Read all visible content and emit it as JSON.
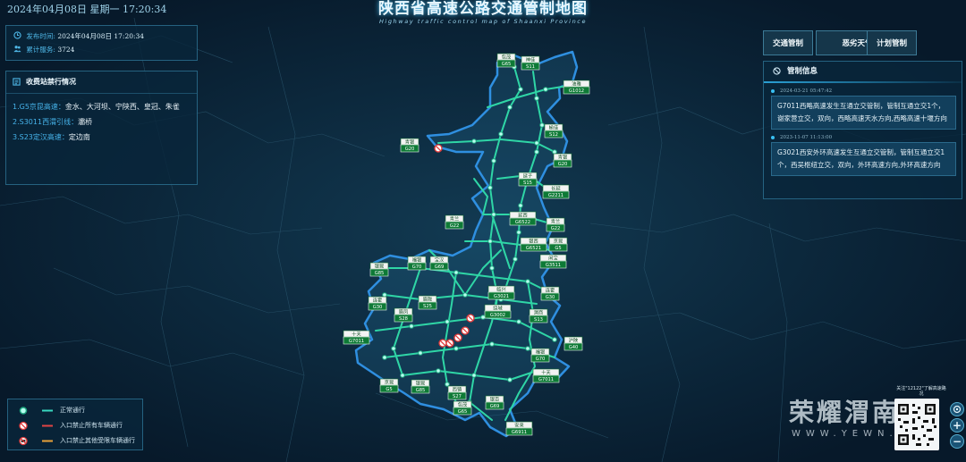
{
  "header": {
    "datetime": "2024年04月08日 星期一 17:20:34",
    "title": "陕西省高速公路交通管制地图",
    "title_en": "Highway traffic control map of Shaanxi Province"
  },
  "info_panel": {
    "publish_label": "发布时间:",
    "publish_value": "2024年04月08日 17:20:34",
    "service_label": "累计服务:",
    "service_value": "3724"
  },
  "toll_panel": {
    "title": "收费站禁行情况",
    "items": [
      {
        "road": "1.G5京昆高速：",
        "stations": "金水、大河坝、宁陕西、皇冠、朱雀"
      },
      {
        "road": "2.S3011西渭引线：",
        "stations": "灞桥"
      },
      {
        "road": "3.S23定汉高速：",
        "stations": "定边南"
      }
    ]
  },
  "tabs": [
    "交通管制",
    "恶劣天气管制",
    "计划管制"
  ],
  "notice": {
    "title": "管制信息",
    "items": [
      {
        "time": "2024-03-21 05:47:42",
        "text": "G7011西略高速发生互通立交管制，管制互通立交1个，谢家营立交，双向，西略高速天水方向,西略高速十堰方向"
      },
      {
        "time": "2023-11-07 11:13:00",
        "text": "G3021西安外环高速发生互通立交管制，管制互通立交1个，西吴枢纽立交，双向，外环高速方向,外环高速方向"
      }
    ]
  },
  "legend": [
    {
      "label": "正常通行",
      "line_color": "#39d9c1",
      "icon": "green-dot-icon"
    },
    {
      "label": "入口禁止所有车辆通行",
      "line_color": "#e04444",
      "icon": "no-entry-icon"
    },
    {
      "label": "入口禁止其他受限车辆通行",
      "line_color": "#e8a23a",
      "icon": "restricted-vehicle-icon"
    }
  ],
  "map_labels": [
    {
      "name": "包茂",
      "code": "G65"
    },
    {
      "name": "神佳",
      "code": "S11"
    },
    {
      "name": "油雅",
      "code": "G1012"
    },
    {
      "name": "榆佳",
      "code": "S12"
    },
    {
      "name": "青银",
      "code": "G20"
    },
    {
      "name": "青银",
      "code": "G20"
    },
    {
      "name": "延子",
      "code": "S15"
    },
    {
      "name": "长延",
      "code": "G2211"
    },
    {
      "name": "延西",
      "code": "G6522"
    },
    {
      "name": "青兰",
      "code": "G22"
    },
    {
      "name": "青兰",
      "code": "G22"
    },
    {
      "name": "银西",
      "code": "G6521"
    },
    {
      "name": "京昆",
      "code": "G5"
    },
    {
      "name": "闲宝",
      "code": "G3511"
    },
    {
      "name": "银昆",
      "code": "G85"
    },
    {
      "name": "福银",
      "code": "G70"
    },
    {
      "name": "宝汉",
      "code": "G69"
    },
    {
      "name": "临兴",
      "code": "G3021"
    },
    {
      "name": "连霍",
      "code": "G30"
    },
    {
      "name": "连霍",
      "code": "G30"
    },
    {
      "name": "眉陇",
      "code": "S25"
    },
    {
      "name": "眉凤",
      "code": "S28"
    },
    {
      "name": "绕城",
      "code": "G3002"
    },
    {
      "name": "渭商",
      "code": "S13"
    },
    {
      "name": "十天",
      "code": "G7011"
    },
    {
      "name": "沪陕",
      "code": "G40"
    },
    {
      "name": "福银",
      "code": "G70"
    },
    {
      "name": "十天",
      "code": "G7011"
    },
    {
      "name": "京昆",
      "code": "G5"
    },
    {
      "name": "银昆",
      "code": "G85"
    },
    {
      "name": "西镇",
      "code": "S27"
    },
    {
      "name": "包茂",
      "code": "G65"
    },
    {
      "name": "银百",
      "code": "G69"
    },
    {
      "name": "安来",
      "code": "G6911"
    }
  ],
  "watermark": {
    "brand": "荣耀渭南",
    "url": "WWW.YEWN.COM"
  },
  "qr_caption": "关注\"12122\"了解高速路况",
  "zoom_controls": {
    "zoom_in": "+",
    "zoom_out": "−"
  }
}
